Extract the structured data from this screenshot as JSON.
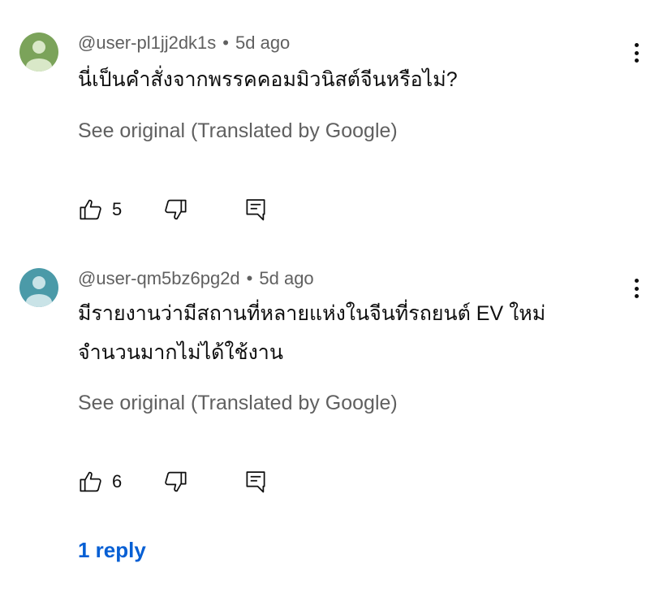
{
  "comments": [
    {
      "author": "@user-pl1jj2dk1s",
      "separator": "•",
      "time": "5d ago",
      "text_lines": [
        "นี่เป็นคำสั่งจากพรรคคอมมิวนิสต์จีนหรือไม่?"
      ],
      "translation_label": "See original (Translated by Google)",
      "likes": "5",
      "avatar_color": "#7ba35a"
    },
    {
      "author": "@user-qm5bz6pg2d",
      "separator": "•",
      "time": "5d ago",
      "text_lines": [
        "มีรายงานว่ามีสถานที่หลายแห่งในจีนที่รถยนต์ EV ใหม่",
        "จำนวนมากไม่ได้ใช้งาน"
      ],
      "translation_label": "See original (Translated by Google)",
      "likes": "6",
      "avatar_color": "#4b9aa8"
    }
  ],
  "replies_label": "1 reply",
  "colors": {
    "link": "#065fd4",
    "secondary_text": "#606060",
    "primary_text": "#0f0f0f"
  },
  "icons": [
    "avatar-icon",
    "more-vert-icon",
    "thumb-up-icon",
    "thumb-down-icon",
    "reply-comment-icon"
  ]
}
